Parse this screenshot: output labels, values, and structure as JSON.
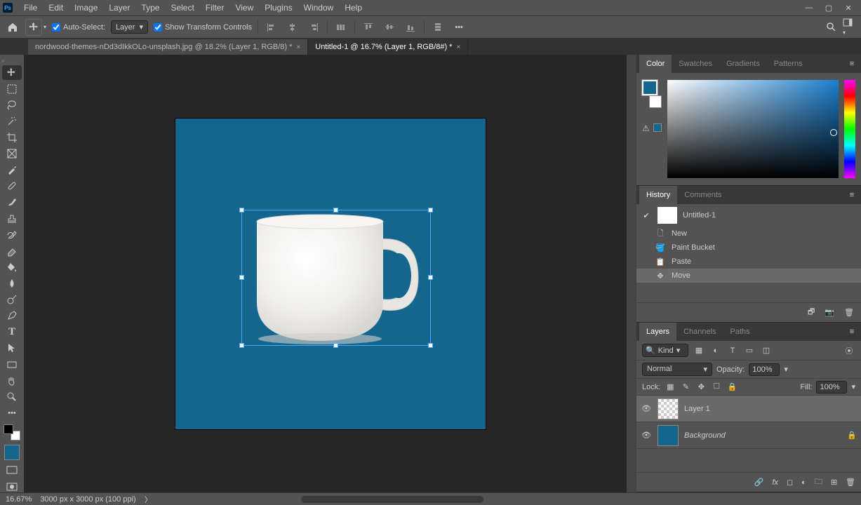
{
  "menu": {
    "file": "File",
    "edit": "Edit",
    "image": "Image",
    "layer": "Layer",
    "type": "Type",
    "select": "Select",
    "filter": "Filter",
    "view": "View",
    "plugins": "Plugins",
    "window": "Window",
    "help": "Help"
  },
  "options": {
    "auto_select": "Auto-Select:",
    "auto_select_target": "Layer",
    "show_transform": "Show Transform Controls"
  },
  "tabs": {
    "0": {
      "title": "nordwood-themes-nDd3dIkkOLo-unsplash.jpg @ 18.2% (Layer 1, RGB/8) *"
    },
    "1": {
      "title": "Untitled-1 @ 16.7% (Layer 1, RGB/8#) *"
    }
  },
  "panels": {
    "color": {
      "tab_color": "Color",
      "tab_swatches": "Swatches",
      "tab_gradients": "Gradients",
      "tab_patterns": "Patterns"
    },
    "history": {
      "tab_history": "History",
      "tab_comments": "Comments",
      "doc": "Untitled-1",
      "items": {
        "0": "New",
        "1": "Paint Bucket",
        "2": "Paste",
        "3": "Move"
      }
    },
    "layers": {
      "tab_layers": "Layers",
      "tab_channels": "Channels",
      "tab_paths": "Paths",
      "filter_kind": "Kind",
      "blend_mode": "Normal",
      "opacity_label": "Opacity:",
      "opacity_value": "100%",
      "lock_label": "Lock:",
      "fill_label": "Fill:",
      "fill_value": "100%",
      "layer1": "Layer 1",
      "background": "Background"
    }
  },
  "status": {
    "zoom": "16.67%",
    "doc_info": "3000 px x 3000 px (100 ppi)"
  },
  "colors": {
    "canvas_fill": "#14668f",
    "fg": "#14668f"
  }
}
